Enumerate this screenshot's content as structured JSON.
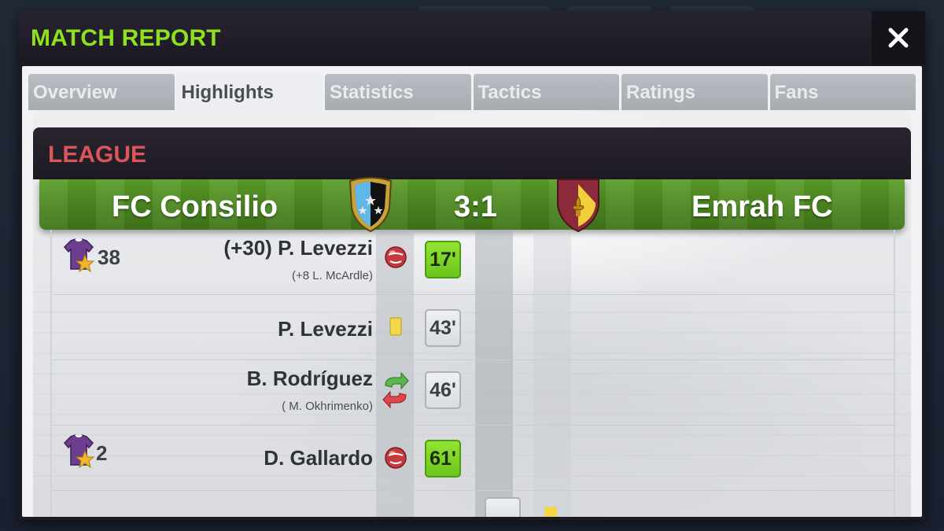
{
  "modal": {
    "title": "MATCH REPORT"
  },
  "tabs": [
    {
      "label": "Overview"
    },
    {
      "label": "Highlights"
    },
    {
      "label": "Statistics"
    },
    {
      "label": "Tactics"
    },
    {
      "label": "Ratings"
    },
    {
      "label": "Fans"
    }
  ],
  "active_tab": "Highlights",
  "league": {
    "label": "LEAGUE"
  },
  "match": {
    "home_team": "FC Consilio",
    "away_team": "Emrah FC",
    "score": "3:1"
  },
  "events": [
    {
      "player": "(+30) P. Levezzi",
      "detail": "(+8 L. McArdle)",
      "event_icon": "ball-icon",
      "minute": "17'",
      "minute_style": "goal",
      "jersey_count": "38"
    },
    {
      "player": "P. Levezzi",
      "detail": "",
      "event_icon": "yellow-card-icon",
      "minute": "43'",
      "minute_style": "plain",
      "jersey_count": ""
    },
    {
      "player": "B. Rodríguez",
      "detail": "( M. Okhrimenko)",
      "event_icon": "substitution-icon",
      "minute": "46'",
      "minute_style": "plain",
      "jersey_count": ""
    },
    {
      "player": "D. Gallardo",
      "detail": "",
      "event_icon": "ball-icon",
      "minute": "61'",
      "minute_style": "goal",
      "jersey_count": "2"
    }
  ],
  "colors": {
    "title_green": "#8ee11c",
    "league_red": "#d9565a",
    "goal_minute_green": "#7dd427",
    "pitch_green": "#4e8a22",
    "jersey_purple": "#6b3f8e",
    "star_gold": "#f4b728"
  }
}
